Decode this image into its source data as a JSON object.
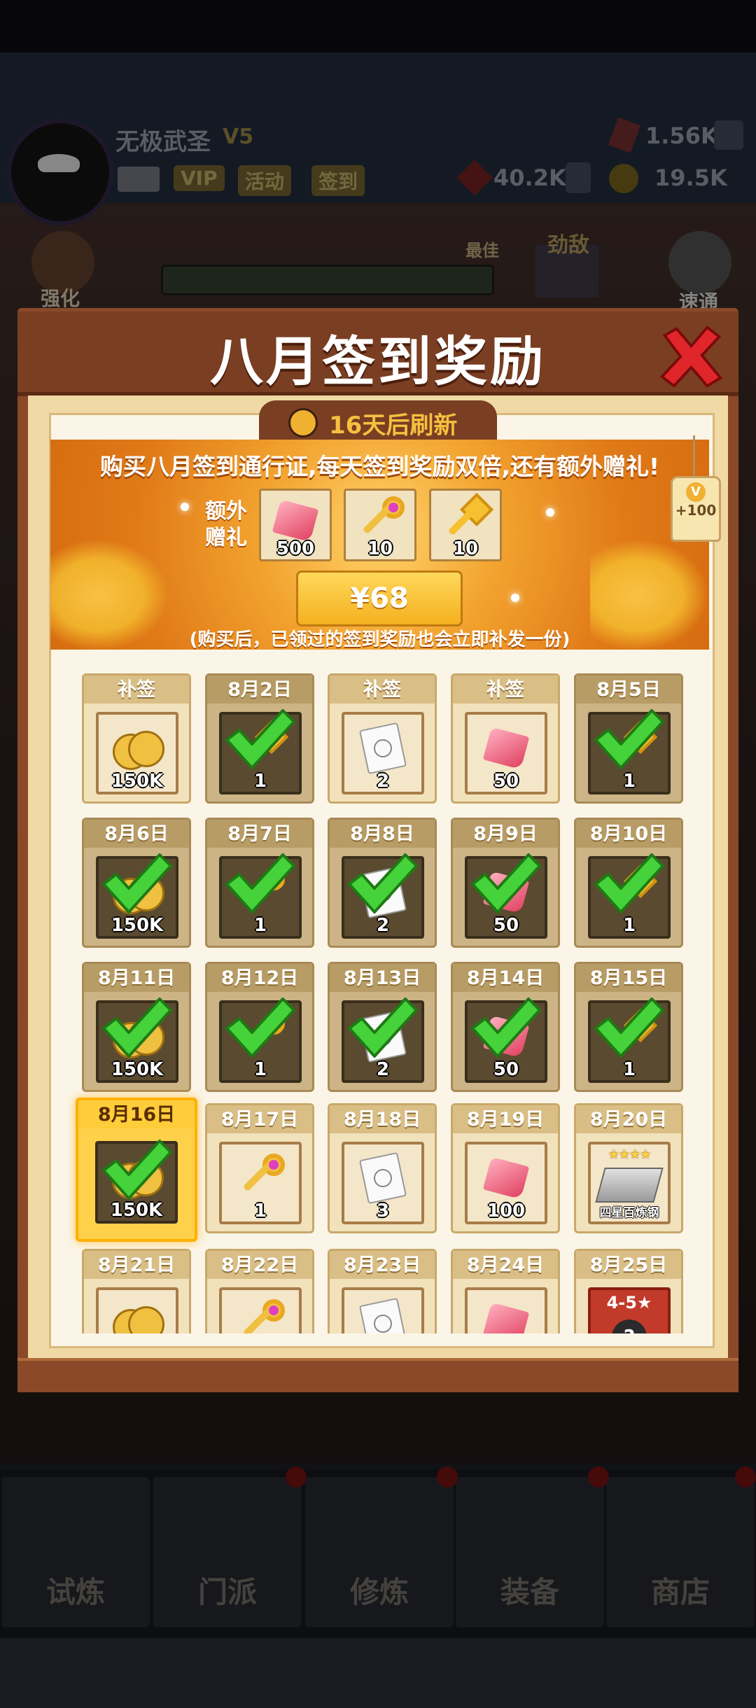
{
  "hud": {
    "player_name": "无极武圣",
    "vip_level": "V5",
    "tags": [
      "VIP",
      "活动",
      "签到"
    ],
    "gems": "1.56K",
    "power": "40.2K",
    "coins": "19.5K",
    "left_button": "强化",
    "right_button": "速通",
    "best_label": "最佳",
    "enemy_label": "劲敌"
  },
  "nav": {
    "tabs": [
      "试炼",
      "门派",
      "修炼",
      "装备",
      "商店"
    ]
  },
  "modal": {
    "title": "八月签到奖励",
    "refresh_text": "16天后刷新",
    "banner_text": "购买八月签到通行证,每天签到奖励双倍,还有额外赠礼!",
    "extra_gift_label": "额外赠礼",
    "extra_gifts": [
      {
        "icon": "gem-icon",
        "count": "500"
      },
      {
        "icon": "key-pink-icon",
        "count": "10"
      },
      {
        "icon": "key-gold-icon",
        "count": "10"
      }
    ],
    "price": "¥68",
    "note": "(购买后，已领过的签到奖励也会立即补发一份)",
    "vip_tag": "+100",
    "vip_tag_icon": "V"
  },
  "calendar": [
    {
      "label": "补签",
      "icon": "coin-icon",
      "count": "150K",
      "state": "makeup"
    },
    {
      "label": "8月2日",
      "icon": "key-gold-icon",
      "count": "1",
      "state": "signed"
    },
    {
      "label": "补签",
      "icon": "scroll-icon",
      "count": "2",
      "state": "makeup"
    },
    {
      "label": "补签",
      "icon": "gem-icon",
      "count": "50",
      "state": "makeup"
    },
    {
      "label": "8月5日",
      "icon": "key-gold-icon",
      "count": "1",
      "state": "signed"
    },
    {
      "label": "8月6日",
      "icon": "coin-icon",
      "count": "150K",
      "state": "signed"
    },
    {
      "label": "8月7日",
      "icon": "key-pink-icon",
      "count": "1",
      "state": "signed"
    },
    {
      "label": "8月8日",
      "icon": "scroll-icon",
      "count": "2",
      "state": "signed"
    },
    {
      "label": "8月9日",
      "icon": "gem-icon",
      "count": "50",
      "state": "signed"
    },
    {
      "label": "8月10日",
      "icon": "key-gold-icon",
      "count": "1",
      "state": "signed"
    },
    {
      "label": "8月11日",
      "icon": "coin-icon",
      "count": "150K",
      "state": "signed"
    },
    {
      "label": "8月12日",
      "icon": "key-pink-icon",
      "count": "1",
      "state": "signed"
    },
    {
      "label": "8月13日",
      "icon": "scroll-icon",
      "count": "2",
      "state": "signed"
    },
    {
      "label": "8月14日",
      "icon": "gem-icon",
      "count": "50",
      "state": "signed"
    },
    {
      "label": "8月15日",
      "icon": "key-gold-icon",
      "count": "1",
      "state": "signed"
    },
    {
      "label": "8月16日",
      "icon": "coin-icon",
      "count": "150K",
      "state": "today"
    },
    {
      "label": "8月17日",
      "icon": "key-pink-icon",
      "count": "1",
      "state": "future"
    },
    {
      "label": "8月18日",
      "icon": "scroll-icon",
      "count": "3",
      "state": "future"
    },
    {
      "label": "8月19日",
      "icon": "gem-icon",
      "count": "100",
      "state": "future"
    },
    {
      "label": "8月20日",
      "icon": "steel-icon",
      "count": "",
      "stars": "★★★★",
      "name": "四星百炼钢",
      "state": "future"
    },
    {
      "label": "8月21日",
      "icon": "coin-icon",
      "count": "",
      "state": "future"
    },
    {
      "label": "8月22日",
      "icon": "key-pink-icon",
      "count": "",
      "state": "future"
    },
    {
      "label": "8月23日",
      "icon": "scroll-icon",
      "count": "",
      "state": "future"
    },
    {
      "label": "8月24日",
      "icon": "gem-icon",
      "count": "",
      "state": "future"
    },
    {
      "label": "8月25日",
      "icon": "mystery-box-icon",
      "count": "",
      "stage": "4-5★",
      "state": "future"
    }
  ]
}
